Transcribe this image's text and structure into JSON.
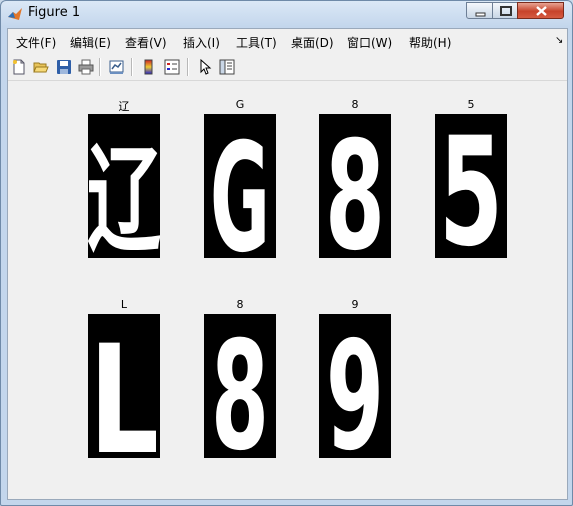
{
  "window": {
    "title": "Figure 1"
  },
  "menu": [
    "文件(F)",
    "编辑(E)",
    "查看(V)",
    "插入(I)",
    "工具(T)",
    "桌面(D)",
    "窗口(W)",
    "帮助(H)"
  ],
  "toolbar_icons": [
    "new-figure-icon",
    "open-file-icon",
    "save-icon",
    "print-icon",
    "link-plot-icon",
    "colorbar-icon",
    "legend-icon",
    "pointer-icon",
    "property-editor-icon"
  ],
  "panels": [
    {
      "title": "辽",
      "glyph": "辽"
    },
    {
      "title": "G",
      "glyph": "G"
    },
    {
      "title": "8",
      "glyph": "8"
    },
    {
      "title": "5",
      "glyph": "5"
    },
    {
      "title": "L",
      "glyph": "L"
    },
    {
      "title": "8",
      "glyph": "8"
    },
    {
      "title": "9",
      "glyph": "9"
    }
  ],
  "colors": {
    "glyph_bg": "#000000",
    "glyph_fg": "#ffffff",
    "close_button": "#c7432b"
  }
}
